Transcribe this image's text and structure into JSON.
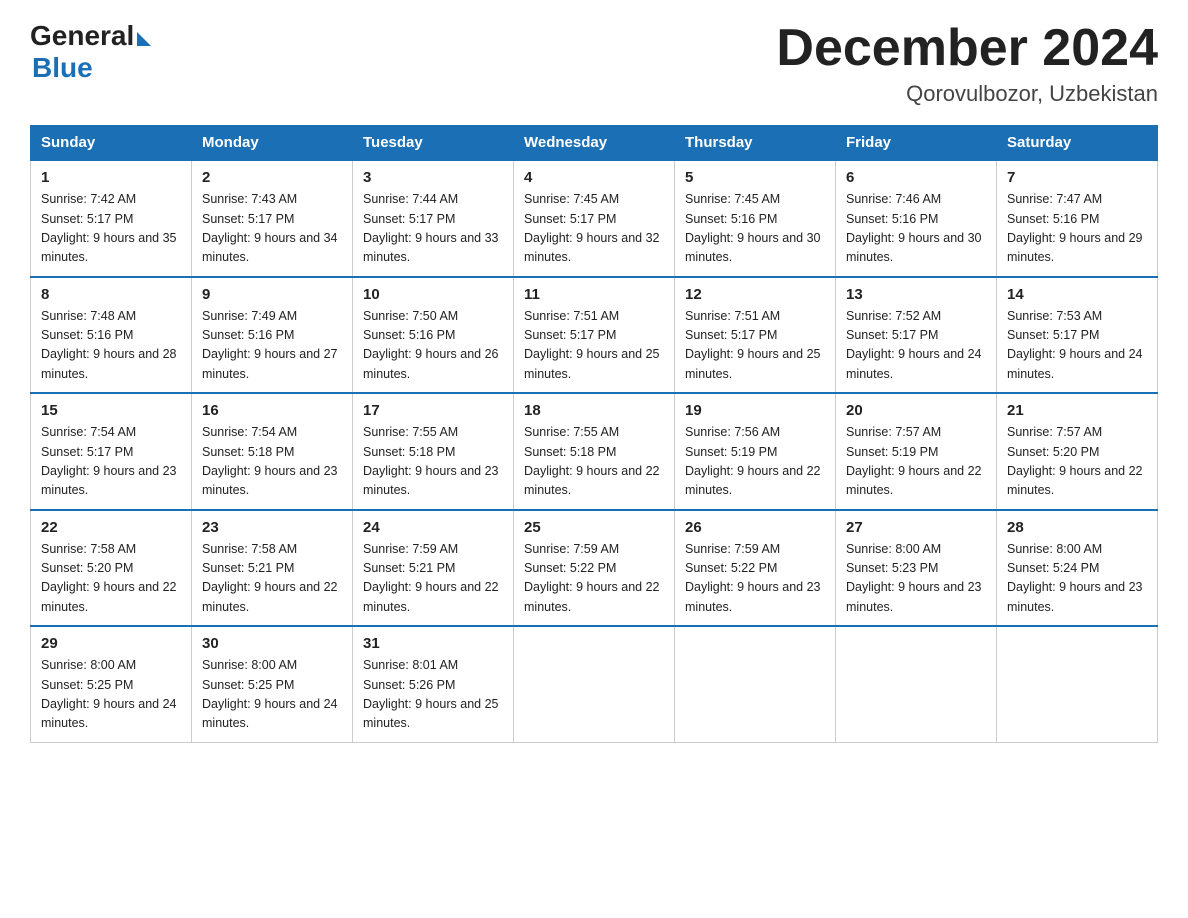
{
  "logo": {
    "general": "General",
    "blue": "Blue"
  },
  "header": {
    "month": "December 2024",
    "location": "Qorovulbozor, Uzbekistan"
  },
  "weekdays": [
    "Sunday",
    "Monday",
    "Tuesday",
    "Wednesday",
    "Thursday",
    "Friday",
    "Saturday"
  ],
  "weeks": [
    [
      {
        "day": 1,
        "sunrise": "7:42 AM",
        "sunset": "5:17 PM",
        "daylight": "9 hours and 35 minutes."
      },
      {
        "day": 2,
        "sunrise": "7:43 AM",
        "sunset": "5:17 PM",
        "daylight": "9 hours and 34 minutes."
      },
      {
        "day": 3,
        "sunrise": "7:44 AM",
        "sunset": "5:17 PM",
        "daylight": "9 hours and 33 minutes."
      },
      {
        "day": 4,
        "sunrise": "7:45 AM",
        "sunset": "5:17 PM",
        "daylight": "9 hours and 32 minutes."
      },
      {
        "day": 5,
        "sunrise": "7:45 AM",
        "sunset": "5:16 PM",
        "daylight": "9 hours and 30 minutes."
      },
      {
        "day": 6,
        "sunrise": "7:46 AM",
        "sunset": "5:16 PM",
        "daylight": "9 hours and 30 minutes."
      },
      {
        "day": 7,
        "sunrise": "7:47 AM",
        "sunset": "5:16 PM",
        "daylight": "9 hours and 29 minutes."
      }
    ],
    [
      {
        "day": 8,
        "sunrise": "7:48 AM",
        "sunset": "5:16 PM",
        "daylight": "9 hours and 28 minutes."
      },
      {
        "day": 9,
        "sunrise": "7:49 AM",
        "sunset": "5:16 PM",
        "daylight": "9 hours and 27 minutes."
      },
      {
        "day": 10,
        "sunrise": "7:50 AM",
        "sunset": "5:16 PM",
        "daylight": "9 hours and 26 minutes."
      },
      {
        "day": 11,
        "sunrise": "7:51 AM",
        "sunset": "5:17 PM",
        "daylight": "9 hours and 25 minutes."
      },
      {
        "day": 12,
        "sunrise": "7:51 AM",
        "sunset": "5:17 PM",
        "daylight": "9 hours and 25 minutes."
      },
      {
        "day": 13,
        "sunrise": "7:52 AM",
        "sunset": "5:17 PM",
        "daylight": "9 hours and 24 minutes."
      },
      {
        "day": 14,
        "sunrise": "7:53 AM",
        "sunset": "5:17 PM",
        "daylight": "9 hours and 24 minutes."
      }
    ],
    [
      {
        "day": 15,
        "sunrise": "7:54 AM",
        "sunset": "5:17 PM",
        "daylight": "9 hours and 23 minutes."
      },
      {
        "day": 16,
        "sunrise": "7:54 AM",
        "sunset": "5:18 PM",
        "daylight": "9 hours and 23 minutes."
      },
      {
        "day": 17,
        "sunrise": "7:55 AM",
        "sunset": "5:18 PM",
        "daylight": "9 hours and 23 minutes."
      },
      {
        "day": 18,
        "sunrise": "7:55 AM",
        "sunset": "5:18 PM",
        "daylight": "9 hours and 22 minutes."
      },
      {
        "day": 19,
        "sunrise": "7:56 AM",
        "sunset": "5:19 PM",
        "daylight": "9 hours and 22 minutes."
      },
      {
        "day": 20,
        "sunrise": "7:57 AM",
        "sunset": "5:19 PM",
        "daylight": "9 hours and 22 minutes."
      },
      {
        "day": 21,
        "sunrise": "7:57 AM",
        "sunset": "5:20 PM",
        "daylight": "9 hours and 22 minutes."
      }
    ],
    [
      {
        "day": 22,
        "sunrise": "7:58 AM",
        "sunset": "5:20 PM",
        "daylight": "9 hours and 22 minutes."
      },
      {
        "day": 23,
        "sunrise": "7:58 AM",
        "sunset": "5:21 PM",
        "daylight": "9 hours and 22 minutes."
      },
      {
        "day": 24,
        "sunrise": "7:59 AM",
        "sunset": "5:21 PM",
        "daylight": "9 hours and 22 minutes."
      },
      {
        "day": 25,
        "sunrise": "7:59 AM",
        "sunset": "5:22 PM",
        "daylight": "9 hours and 22 minutes."
      },
      {
        "day": 26,
        "sunrise": "7:59 AM",
        "sunset": "5:22 PM",
        "daylight": "9 hours and 23 minutes."
      },
      {
        "day": 27,
        "sunrise": "8:00 AM",
        "sunset": "5:23 PM",
        "daylight": "9 hours and 23 minutes."
      },
      {
        "day": 28,
        "sunrise": "8:00 AM",
        "sunset": "5:24 PM",
        "daylight": "9 hours and 23 minutes."
      }
    ],
    [
      {
        "day": 29,
        "sunrise": "8:00 AM",
        "sunset": "5:25 PM",
        "daylight": "9 hours and 24 minutes."
      },
      {
        "day": 30,
        "sunrise": "8:00 AM",
        "sunset": "5:25 PM",
        "daylight": "9 hours and 24 minutes."
      },
      {
        "day": 31,
        "sunrise": "8:01 AM",
        "sunset": "5:26 PM",
        "daylight": "9 hours and 25 minutes."
      },
      null,
      null,
      null,
      null
    ]
  ]
}
